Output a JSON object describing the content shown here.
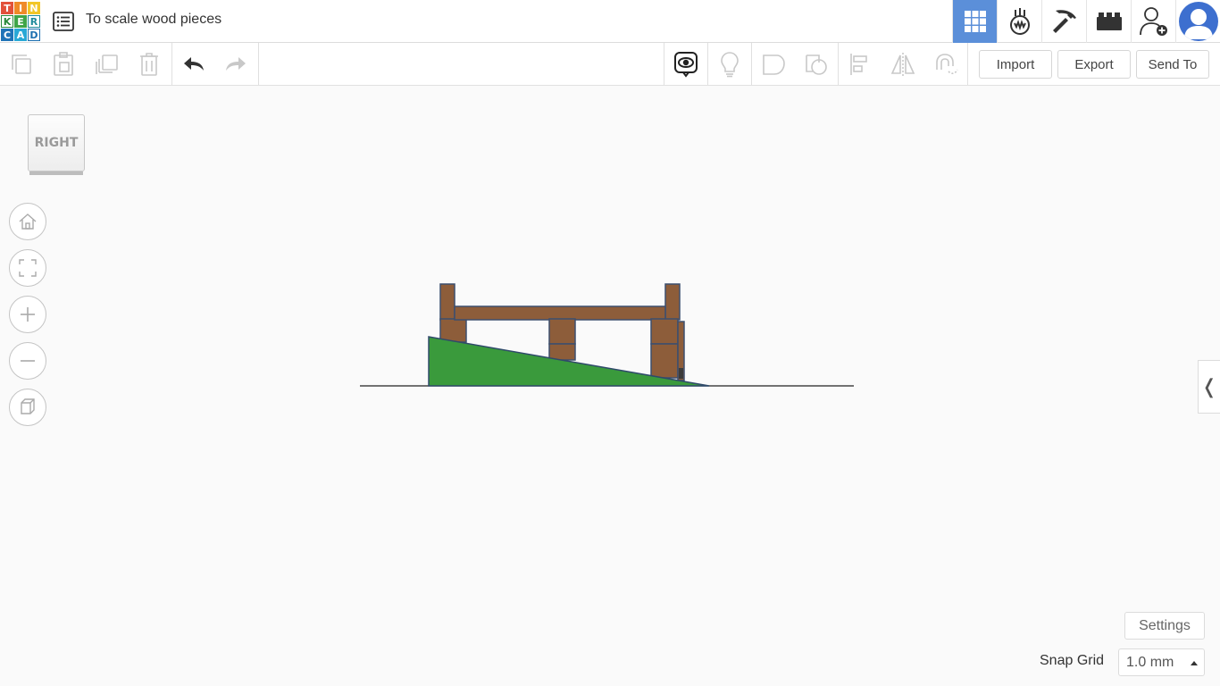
{
  "app": {
    "logo_letters": [
      "T",
      "I",
      "N",
      "K",
      "E",
      "R",
      "C",
      "A",
      "D"
    ],
    "doc_title": "To scale wood pieces"
  },
  "top_right": {
    "buttons": [
      {
        "name": "3d-design-grid",
        "icon": "grid-icon",
        "active": true
      },
      {
        "name": "circuits",
        "icon": "circuits-icon",
        "active": false
      },
      {
        "name": "minecraft-mode",
        "icon": "pickaxe-icon",
        "active": false
      },
      {
        "name": "lego-bricks",
        "icon": "brick-icon",
        "active": false
      },
      {
        "name": "invite-user",
        "icon": "add-user-icon",
        "active": false
      }
    ],
    "avatar": "user-avatar"
  },
  "toolbar": {
    "import_label": "Import",
    "export_label": "Export",
    "send_to_label": "Send To"
  },
  "viewcube": {
    "face_label": "RIGHT"
  },
  "side_panel": {
    "toggle_glyph": "❬"
  },
  "footer": {
    "settings_label": "Settings",
    "snap_grid_label": "Snap Grid",
    "snap_grid_value": "1.0 mm"
  },
  "colors": {
    "wood": "#8d5d3a",
    "wood_edge": "#3d4f6e",
    "ramp": "#3a9a3c",
    "active_button": "#5b8fd9",
    "avatar": "#3d6fcf"
  }
}
